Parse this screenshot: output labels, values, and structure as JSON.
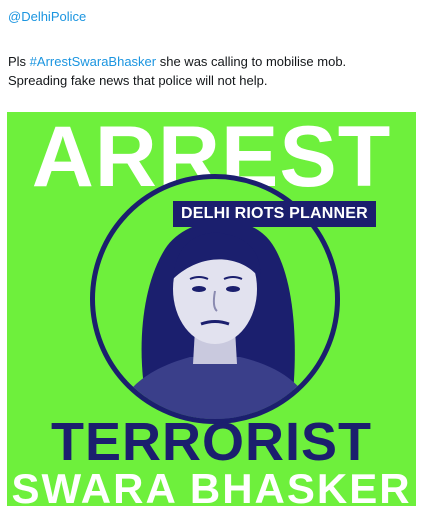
{
  "tweet": {
    "handle": "@DelhiPolice",
    "text_prefix": "Pls ",
    "hashtag": "#ArrestSwaraBhasker",
    "text_line1_suffix": " she was calling to mobilise mob.",
    "text_line2": "Spreading fake news that police will not help."
  },
  "poster": {
    "headline": "ARREST",
    "tag": "DELHI RIOTS PLANNER",
    "label": "TERRORIST",
    "name": "SWARA BHASKER",
    "colors": {
      "background": "#6ef03c",
      "navy": "#1b1f6e",
      "white": "#ffffff"
    }
  }
}
